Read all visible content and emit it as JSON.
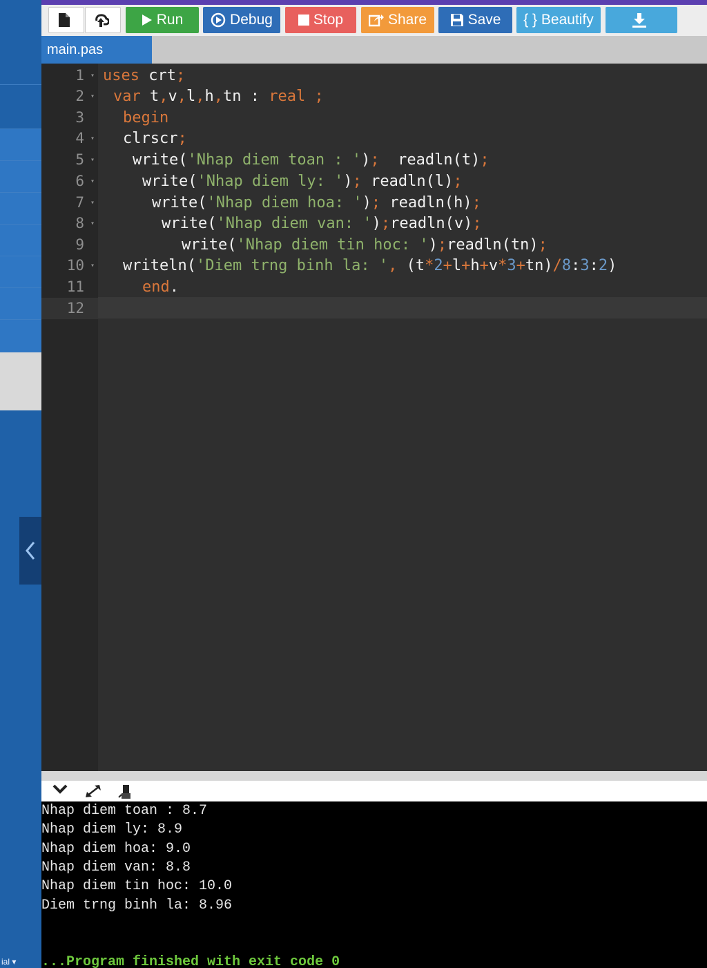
{
  "toolbar": {
    "new_icon": "file-icon",
    "upload_icon": "upload-icon",
    "run_label": "Run",
    "debug_label": "Debug",
    "stop_label": "Stop",
    "share_label": "Share",
    "save_label": "Save",
    "beautify_label": "{ } Beautify",
    "download_icon": "download-icon"
  },
  "tabs": [
    {
      "label": "main.pas"
    }
  ],
  "editor": {
    "line_numbers": [
      "1",
      "2",
      "3",
      "4",
      "5",
      "6",
      "7",
      "8",
      "9",
      "10",
      "11",
      "12"
    ],
    "lines": [
      "uses crt;",
      "var t,v,l,h,tn : real ;",
      "begin",
      "clrscr;",
      "write('Nhap diem toan : ');  readln(t);",
      "write('Nhap diem ly: '); readln(l);",
      "write('Nhap diem hoa: '); readln(h);",
      "write('Nhap diem van: ');readln(v);",
      "write('Nhap diem tin hoc: ');readln(tn);",
      "writeln('Diem trng binh la: ', (t*2+l+h+v*3+tn)/8:3:2)",
      "end.",
      ""
    ]
  },
  "console": {
    "output": [
      "Nhap diem toan : 8.7",
      "Nhap diem ly: 8.9",
      "Nhap diem hoa: 9.0",
      "Nhap diem van: 8.8",
      "Nhap diem tin hoc: 10.0",
      "Diem trng binh la: 8.96"
    ],
    "finish": "...Program finished with exit code 0"
  },
  "sidebar": {
    "bottom_text": "ial ▾"
  },
  "colors": {
    "keyword": "#d9773b",
    "string": "#8fb26b",
    "number": "#6a98c8",
    "run": "#3da545",
    "debug": "#2e6db7",
    "stop": "#e8605d",
    "share": "#f29a3b",
    "beautify": "#48a8dc"
  }
}
